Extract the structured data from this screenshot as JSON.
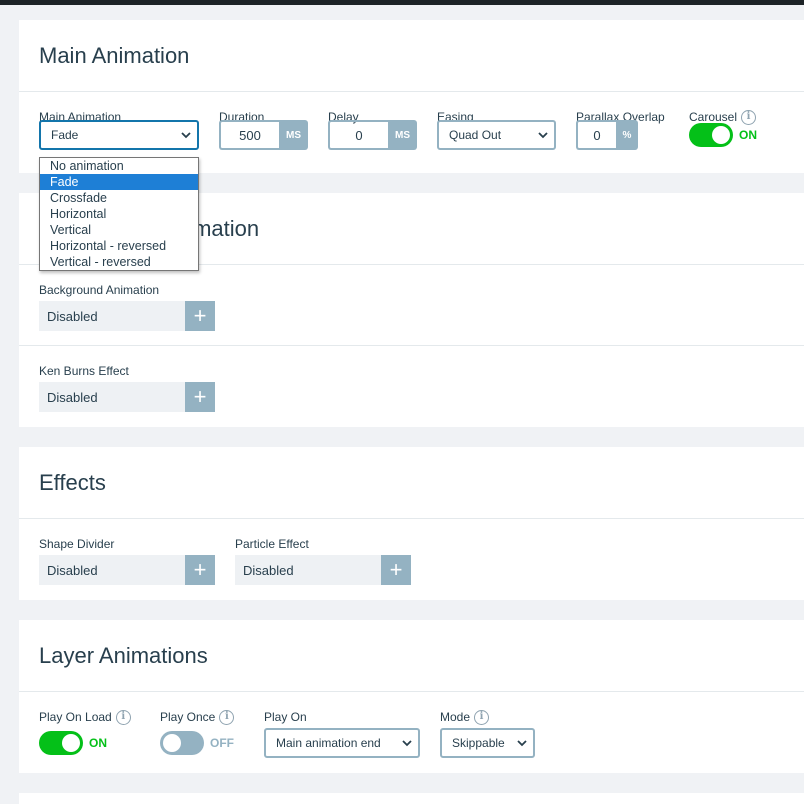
{
  "main_card": {
    "title": "Main Animation",
    "fields": {
      "main_animation": {
        "label": "Main Animation",
        "value": "Fade"
      },
      "duration": {
        "label": "Duration",
        "value": "500",
        "unit": "MS"
      },
      "delay": {
        "label": "Delay",
        "value": "0",
        "unit": "MS"
      },
      "easing": {
        "label": "Easing",
        "value": "Quad Out"
      },
      "parallax": {
        "label": "Parallax Overlap",
        "value": "0",
        "unit": "%"
      },
      "carousel": {
        "label": "Carousel",
        "state": "ON"
      }
    },
    "dropdown_options": [
      "No animation",
      "Fade",
      "Crossfade",
      "Horizontal",
      "Vertical",
      "Horizontal - reversed",
      "Vertical - reversed"
    ],
    "dropdown_selected": "Fade"
  },
  "bg_card": {
    "title": "Background Animation",
    "background_animation": {
      "label": "Background Animation",
      "value": "Disabled"
    },
    "ken_burns": {
      "label": "Ken Burns Effect",
      "value": "Disabled"
    }
  },
  "effects_card": {
    "title": "Effects",
    "shape_divider": {
      "label": "Shape Divider",
      "value": "Disabled"
    },
    "particle_effect": {
      "label": "Particle Effect",
      "value": "Disabled"
    }
  },
  "layer_card": {
    "title": "Layer Animations",
    "play_on_load": {
      "label": "Play On Load",
      "state": "ON"
    },
    "play_once": {
      "label": "Play Once",
      "state": "OFF"
    },
    "play_on": {
      "label": "Play On",
      "value": "Main animation end"
    },
    "mode": {
      "label": "Mode",
      "value": "Skippable"
    }
  },
  "colors": {
    "accent": "#04c018",
    "muted": "#94b2c2",
    "text": "#283f4d",
    "selection": "#1e7fd6"
  },
  "icons": {
    "info": "info-icon",
    "plus": "plus-icon",
    "chevron": "chevron-down-icon"
  }
}
